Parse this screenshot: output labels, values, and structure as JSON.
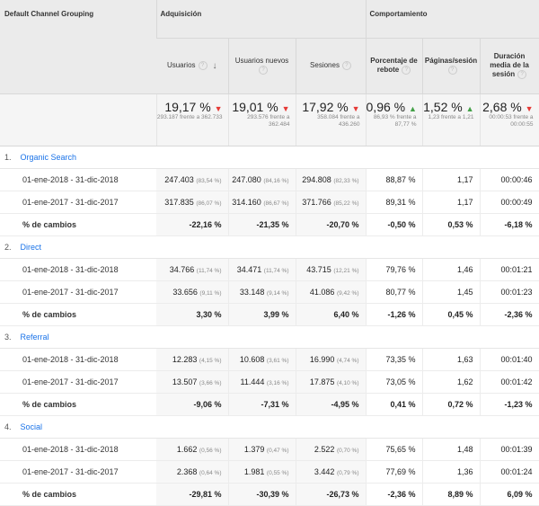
{
  "header": {
    "group_label": "Default Channel Grouping",
    "adquisicion": "Adquisición",
    "comportamiento": "Comportamiento",
    "cols": [
      {
        "label": "Usuarios"
      },
      {
        "label": "Usuarios nuevos"
      },
      {
        "label": "Sesiones"
      },
      {
        "label": "Porcentaje de rebote"
      },
      {
        "label": "Páginas/sesión"
      },
      {
        "label": "Duración media de la sesión"
      }
    ],
    "help_glyph": "?",
    "sort_glyph": "↓"
  },
  "totals": [
    {
      "value": "19,17 %",
      "sub": "293.187 frente a 362.733",
      "dir": "down"
    },
    {
      "value": "19,01 %",
      "sub": "293.576 frente a 362.484",
      "dir": "down"
    },
    {
      "value": "17,92 %",
      "sub": "358.084 frente a 436.260",
      "dir": "down"
    },
    {
      "value": "0,96 %",
      "sub": "86,93 % frente a 87,77 %",
      "dir": "up"
    },
    {
      "value": "1,52 %",
      "sub": "1,23 frente a 1,21",
      "dir": "up"
    },
    {
      "value": "2,68 %",
      "sub": "00:00:53 frente a 00:00:55",
      "dir": "down"
    }
  ],
  "groups": [
    {
      "index": "1.",
      "name": "Organic Search",
      "r1": {
        "label": "01-ene-2018 - 31-dic-2018",
        "u": "247.403",
        "up": "(83,54 %)",
        "nu": "247.080",
        "nup": "(84,16 %)",
        "s": "294.808",
        "sp": "(82,33 %)",
        "br": "88,87 %",
        "ps": "1,17",
        "d": "00:00:46"
      },
      "r2": {
        "label": "01-ene-2017 - 31-dic-2017",
        "u": "317.835",
        "up": "(86,07 %)",
        "nu": "314.160",
        "nup": "(86,67 %)",
        "s": "371.766",
        "sp": "(85,22 %)",
        "br": "89,31 %",
        "ps": "1,17",
        "d": "00:00:49"
      },
      "r3": {
        "label": "% de cambios",
        "u": "-22,16 %",
        "nu": "-21,35 %",
        "s": "-20,70 %",
        "br": "-0,50 %",
        "ps": "0,53 %",
        "d": "-6,18 %"
      }
    },
    {
      "index": "2.",
      "name": "Direct",
      "r1": {
        "label": "01-ene-2018 - 31-dic-2018",
        "u": "34.766",
        "up": "(11,74 %)",
        "nu": "34.471",
        "nup": "(11,74 %)",
        "s": "43.715",
        "sp": "(12,21 %)",
        "br": "79,76 %",
        "ps": "1,46",
        "d": "00:01:21"
      },
      "r2": {
        "label": "01-ene-2017 - 31-dic-2017",
        "u": "33.656",
        "up": "(9,11 %)",
        "nu": "33.148",
        "nup": "(9,14 %)",
        "s": "41.086",
        "sp": "(9,42 %)",
        "br": "80,77 %",
        "ps": "1,45",
        "d": "00:01:23"
      },
      "r3": {
        "label": "% de cambios",
        "u": "3,30 %",
        "nu": "3,99 %",
        "s": "6,40 %",
        "br": "-1,26 %",
        "ps": "0,45 %",
        "d": "-2,36 %"
      }
    },
    {
      "index": "3.",
      "name": "Referral",
      "r1": {
        "label": "01-ene-2018 - 31-dic-2018",
        "u": "12.283",
        "up": "(4,15 %)",
        "nu": "10.608",
        "nup": "(3,61 %)",
        "s": "16.990",
        "sp": "(4,74 %)",
        "br": "73,35 %",
        "ps": "1,63",
        "d": "00:01:40"
      },
      "r2": {
        "label": "01-ene-2017 - 31-dic-2017",
        "u": "13.507",
        "up": "(3,66 %)",
        "nu": "11.444",
        "nup": "(3,16 %)",
        "s": "17.875",
        "sp": "(4,10 %)",
        "br": "73,05 %",
        "ps": "1,62",
        "d": "00:01:42"
      },
      "r3": {
        "label": "% de cambios",
        "u": "-9,06 %",
        "nu": "-7,31 %",
        "s": "-4,95 %",
        "br": "0,41 %",
        "ps": "0,72 %",
        "d": "-1,23 %"
      }
    },
    {
      "index": "4.",
      "name": "Social",
      "r1": {
        "label": "01-ene-2018 - 31-dic-2018",
        "u": "1.662",
        "up": "(0,56 %)",
        "nu": "1.379",
        "nup": "(0,47 %)",
        "s": "2.522",
        "sp": "(0,70 %)",
        "br": "75,65 %",
        "ps": "1,48",
        "d": "00:01:39"
      },
      "r2": {
        "label": "01-ene-2017 - 31-dic-2017",
        "u": "2.368",
        "up": "(0,64 %)",
        "nu": "1.981",
        "nup": "(0,55 %)",
        "s": "3.442",
        "sp": "(0,79 %)",
        "br": "77,69 %",
        "ps": "1,36",
        "d": "00:01:24"
      },
      "r3": {
        "label": "% de cambios",
        "u": "-29,81 %",
        "nu": "-30,39 %",
        "s": "-26,73 %",
        "br": "-2,36 %",
        "ps": "8,89 %",
        "d": "6,09 %"
      }
    }
  ]
}
